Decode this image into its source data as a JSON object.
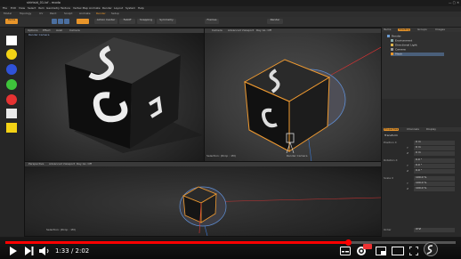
{
  "window": {
    "title": "shirtsid_01.lxf - modo"
  },
  "menu": [
    "File",
    "Edit",
    "View",
    "Select",
    "Item",
    "Geometry",
    "Texture",
    "Vertex Map",
    "Animate",
    "Render",
    "Layout",
    "System",
    "Help"
  ],
  "layout_tabs": [
    "Model",
    "Topology",
    "UV",
    "Paint",
    "Sculpt",
    "Animate",
    "Render",
    "Setup"
  ],
  "toolbar": {
    "mode": "Items",
    "tools": [
      "Action Center",
      "Falloff",
      "Snapping",
      "Symmetry"
    ],
    "render": "Render",
    "frames": "Frames"
  },
  "viewports": {
    "render": {
      "tabs": [
        "Options",
        "Effect",
        "Avail",
        "Camera"
      ],
      "label": "Render Camera"
    },
    "perspective": {
      "tabs": [
        "Camera",
        "Advanced Viewport",
        "Ray GL: Off"
      ],
      "bottom_status": "Selection: (Drop : 1M)",
      "right_status": "Render Camera"
    },
    "bottom": {
      "tabs": [
        "Perspective",
        "Advanced Viewport",
        "Ray GL: Off"
      ],
      "status": "Selection: (Drop : 1M)"
    }
  },
  "items_panel": {
    "tabs": [
      "Items",
      "Shading",
      "Groups",
      "Images"
    ],
    "rows": [
      "Render",
      "Environment",
      "Directional Light",
      "Camera",
      "Mesh"
    ]
  },
  "properties_panel": {
    "tabs": [
      "Properties",
      "Channels",
      "Display"
    ],
    "section": "Transform",
    "rows": [
      {
        "label": "Position X",
        "value": "0 m"
      },
      {
        "label": "Y",
        "value": "0 m"
      },
      {
        "label": "Z",
        "value": "0 m"
      },
      {
        "label": "Rotation X",
        "value": "0.0 °"
      },
      {
        "label": "Y",
        "value": "0.0 °"
      },
      {
        "label": "Z",
        "value": "0.0 °"
      },
      {
        "label": "Scale X",
        "value": "100.0 %"
      },
      {
        "label": "Y",
        "value": "100.0 %"
      },
      {
        "label": "Z",
        "value": "100.0 %"
      },
      {
        "label": "Order",
        "value": "XYZ"
      }
    ]
  },
  "palette_colors": [
    "#ffffff",
    "#f2d315",
    "#2f52d8",
    "#3ec43b",
    "#e63232",
    "#e9e9e9",
    "#f3d215"
  ],
  "player": {
    "current_time": "1:33",
    "duration": "2:02",
    "time_text": "1:33 / 2:02",
    "progress": 0.762,
    "icons": [
      "play-icon",
      "next-icon",
      "volume-icon",
      "subtitles-icon",
      "settings-icon",
      "miniplayer-icon",
      "theater-icon",
      "fullscreen-icon"
    ]
  }
}
